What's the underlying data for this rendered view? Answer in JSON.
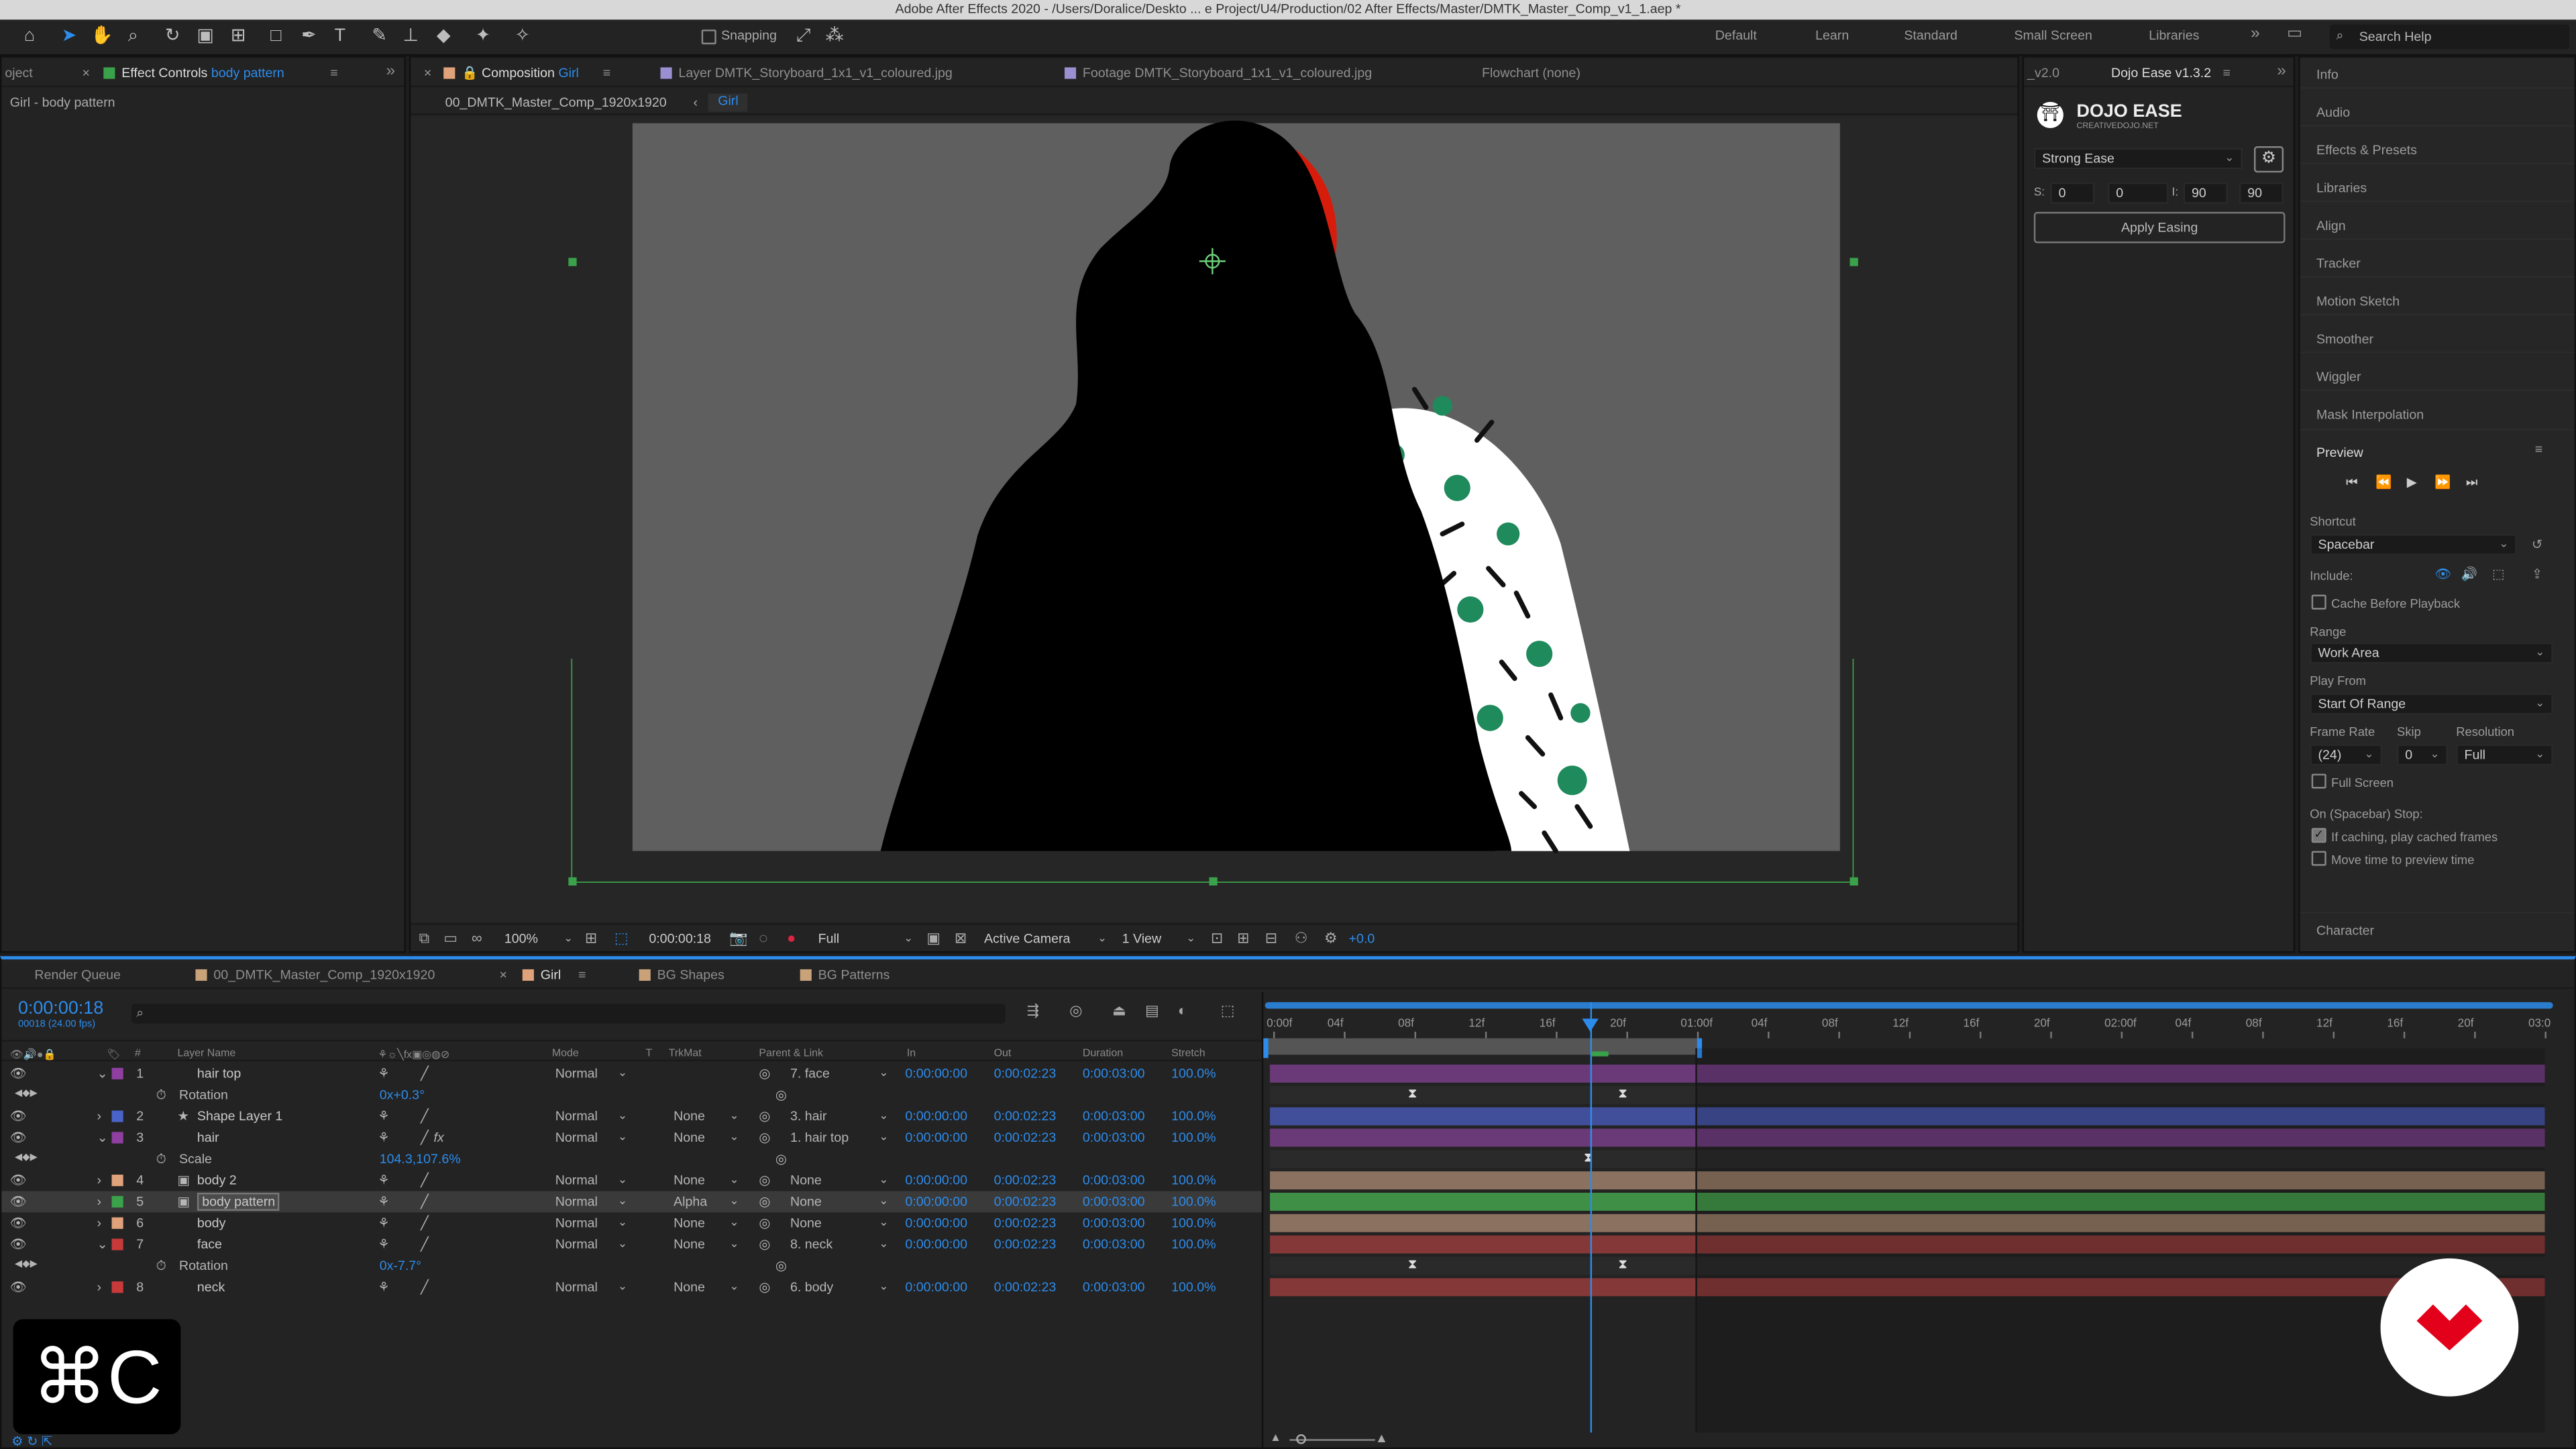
{
  "window": {
    "title": "Adobe After Effects 2020 - /Users/Doralice/Deskto ... e Project/U4/Production/02 After Effects/Master/DMTK_Master_Comp_v1_1.aep *"
  },
  "toolbar": {
    "snapping": "Snapping",
    "workspaces": [
      "Default",
      "Learn",
      "Standard",
      "Small Screen",
      "Libraries"
    ],
    "search_placeholder": "Search Help"
  },
  "left_panel": {
    "tab_project": "oject",
    "tab_effect": "Effect Controls",
    "tab_effect_layer": "body pattern",
    "breadcrumb": "Girl - body pattern"
  },
  "viewer": {
    "tab_comp": "Composition",
    "tab_comp_name": "Girl",
    "tab_layer": "Layer DMTK_Storyboard_1x1_v1_coloured.jpg",
    "tab_footage": "Footage DMTK_Storyboard_1x1_v1_coloured.jpg",
    "tab_flowchart": "Flowchart (none)",
    "crumb_master": "00_DMTK_Master_Comp_1920x1920",
    "crumb_girl": "Girl",
    "zoom": "100%",
    "timecode": "0:00:00:18",
    "resolution": "Full",
    "camera": "Active Camera",
    "view": "1 View",
    "exposure": "+0.0"
  },
  "dojo": {
    "tab_prev": "_v2.0",
    "tab": "Dojo Ease v1.3.2",
    "logo": "DOJO EASE",
    "logo_sub": "CREATIVEDOJO.NET",
    "preset": "Strong Ease",
    "s_label": "S:",
    "s1": "0",
    "s2": "0",
    "i_label": "I:",
    "i1": "90",
    "i2": "90",
    "apply": "Apply Easing"
  },
  "right_panel": {
    "items": [
      "Info",
      "Audio",
      "Effects & Presets",
      "Libraries",
      "Align",
      "Tracker",
      "Motion Sketch",
      "Smoother",
      "Wiggler",
      "Mask Interpolation"
    ],
    "preview": {
      "title": "Preview",
      "shortcut_label": "Shortcut",
      "shortcut": "Spacebar",
      "include_label": "Include:",
      "cache": "Cache Before Playback",
      "range_label": "Range",
      "range": "Work Area",
      "play_from_label": "Play From",
      "play_from": "Start Of Range",
      "frame_rate_label": "Frame Rate",
      "skip_label": "Skip",
      "resolution_label": "Resolution",
      "frame_rate": "(24)",
      "skip": "0",
      "resolution": "Full",
      "full_screen": "Full Screen",
      "on_stop": "On (Spacebar) Stop:",
      "if_caching": "If caching, play cached frames",
      "move_time": "Move time to preview time"
    },
    "character": "Character"
  },
  "timeline": {
    "tabs": {
      "render": "Render Queue",
      "master": "00_DMTK_Master_Comp_1920x1920",
      "girl": "Girl",
      "bg_shapes": "BG Shapes",
      "bg_patterns": "BG Patterns"
    },
    "current_time": "0:00:00:18",
    "frames": "00018 (24.00 fps)",
    "headers": {
      "num": "#",
      "layer_name": "Layer Name",
      "mode": "Mode",
      "t": "T",
      "trkmat": "TrkMat",
      "parent": "Parent & Link",
      "in": "In",
      "out": "Out",
      "duration": "Duration",
      "stretch": "Stretch"
    },
    "ruler": [
      "0:00f",
      "04f",
      "08f",
      "12f",
      "16f",
      "20f",
      "01:00f",
      "04f",
      "08f",
      "12f",
      "16f",
      "20f",
      "02:00f",
      "04f",
      "08f",
      "12f",
      "16f",
      "20f",
      "03:0"
    ],
    "rows": [
      {
        "kind": "layer",
        "num": "1",
        "name": "hair top",
        "color": "#8e3fa0",
        "mode": "Normal",
        "trkmat": "",
        "parent": "7. face",
        "in": "0:00:00:00",
        "out": "0:00:02:23",
        "dur": "0:00:03:00",
        "stretch": "100.0%",
        "bar": "#6a3a78",
        "fx": false,
        "icon": "",
        "twirl": "v"
      },
      {
        "kind": "prop",
        "name": "Rotation",
        "value": "0x+0.3°",
        "bar": "#2a2a2a"
      },
      {
        "kind": "layer",
        "num": "2",
        "name": "Shape Layer 1",
        "color": "#4a63c9",
        "mode": "Normal",
        "trkmat": "None",
        "parent": "3. hair",
        "in": "0:00:00:00",
        "out": "0:00:02:23",
        "dur": "0:00:03:00",
        "stretch": "100.0%",
        "bar": "#414f9a",
        "fx": false,
        "icon": "★",
        "twirl": ">"
      },
      {
        "kind": "layer",
        "num": "3",
        "name": "hair",
        "color": "#8e3fa0",
        "mode": "Normal",
        "trkmat": "None",
        "parent": "1. hair top",
        "in": "0:00:00:00",
        "out": "0:00:02:23",
        "dur": "0:00:03:00",
        "stretch": "100.0%",
        "bar": "#6a3a78",
        "fx": true,
        "icon": "",
        "twirl": "v"
      },
      {
        "kind": "prop",
        "name": "Scale",
        "value": "104.3,107.6%",
        "bar": "#2a2a2a"
      },
      {
        "kind": "layer",
        "num": "4",
        "name": "body 2",
        "color": "#e0a27a",
        "mode": "Normal",
        "trkmat": "None",
        "parent": "None",
        "in": "0:00:00:00",
        "out": "0:00:02:23",
        "dur": "0:00:03:00",
        "stretch": "100.0%",
        "bar": "#8b7260",
        "fx": false,
        "icon": "▣",
        "twirl": ">"
      },
      {
        "kind": "layer",
        "num": "5",
        "name": "body pattern",
        "color": "#3aa24a",
        "mode": "Normal",
        "trkmat": "Alpha",
        "parent": "None",
        "in": "0:00:00:00",
        "out": "0:00:02:23",
        "dur": "0:00:03:00",
        "stretch": "100.0%",
        "bar": "#3f8f46",
        "fx": false,
        "icon": "▣",
        "twirl": ">",
        "selected": true
      },
      {
        "kind": "layer",
        "num": "6",
        "name": "body",
        "color": "#e0a27a",
        "mode": "Normal",
        "trkmat": "None",
        "parent": "None",
        "in": "0:00:00:00",
        "out": "0:00:02:23",
        "dur": "0:00:03:00",
        "stretch": "100.0%",
        "bar": "#8b7260",
        "fx": false,
        "icon": "",
        "twirl": ">"
      },
      {
        "kind": "layer",
        "num": "7",
        "name": "face",
        "color": "#c83a3a",
        "mode": "Normal",
        "trkmat": "None",
        "parent": "8. neck",
        "in": "0:00:00:00",
        "out": "0:00:02:23",
        "dur": "0:00:03:00",
        "stretch": "100.0%",
        "bar": "#843838",
        "fx": false,
        "icon": "",
        "twirl": "v"
      },
      {
        "kind": "prop",
        "name": "Rotation",
        "value": "0x-7.7°",
        "bar": "#2a2a2a"
      },
      {
        "kind": "layer",
        "num": "8",
        "name": "neck",
        "color": "#c83a3a",
        "mode": "Normal",
        "trkmat": "None",
        "parent": "6. body",
        "in": "0:00:00:00",
        "out": "0:00:02:23",
        "dur": "0:00:03:00",
        "stretch": "100.0%",
        "bar": "#843838",
        "fx": false,
        "icon": "",
        "twirl": ">"
      }
    ]
  },
  "overlay": {
    "shortcut": "⌘C"
  },
  "colors": {
    "accent": "#2d8ceb",
    "bg_panel": "#232323",
    "bg_dark": "#1d1d1d"
  }
}
